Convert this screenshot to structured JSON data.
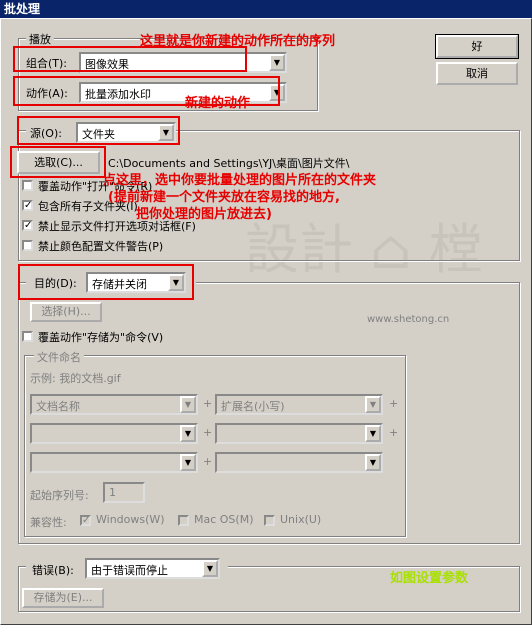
{
  "window": {
    "title": "批处理"
  },
  "buttons": {
    "ok": "好",
    "cancel": "取消"
  },
  "play": {
    "legend": "播放",
    "set_label": "组合(T):",
    "set_value": "图像效果",
    "action_label": "动作(A):",
    "action_value": "批量添加水印"
  },
  "source": {
    "label": "源(O):",
    "value": "文件夹",
    "choose_button": "选取(C)...",
    "path": "C:\\Documents and Settings\\YJ\\桌面\\图片文件\\",
    "override_open": "覆盖动作\"打开\"命令(R)",
    "include_subfolders": "包含所有子文件夹(I)",
    "suppress_dialogs": "禁止显示文件打开选项对话框(F)",
    "suppress_color": "禁止颜色配置文件警告(P)"
  },
  "destination": {
    "label": "目的(D):",
    "value": "存储并关闭",
    "choose_button": "选择(H)...",
    "override_save": "覆盖动作\"存储为\"命令(V)",
    "naming_legend": "文件命名",
    "example": "示例: 我的文档.gif",
    "name_field1": "文档名称",
    "name_field2": "扩展名(小写)",
    "plus": "+",
    "serial_label": "起始序列号:",
    "serial_value": "1",
    "compat_label": "兼容性:",
    "compat_windows": "Windows(W)",
    "compat_mac": "Mac OS(M)",
    "compat_unix": "Unix(U)"
  },
  "errors": {
    "label": "错误(B):",
    "value": "由于错误而停止",
    "save_as_button": "存储为(E)..."
  },
  "annotations": {
    "sequence_note": "这里就是你新建的动作所在的序列",
    "action_note": "新建的动作",
    "click_note_1": "点这里，选中你要批量处理的图片所在的文件夹",
    "click_note_2": "(提前新建一个文件夹放在容易找的地方,",
    "click_note_3": "把你处理的图片放进去)",
    "settings_note": "如图设置参数"
  },
  "watermark": {
    "url": "www.shetong.cn"
  }
}
